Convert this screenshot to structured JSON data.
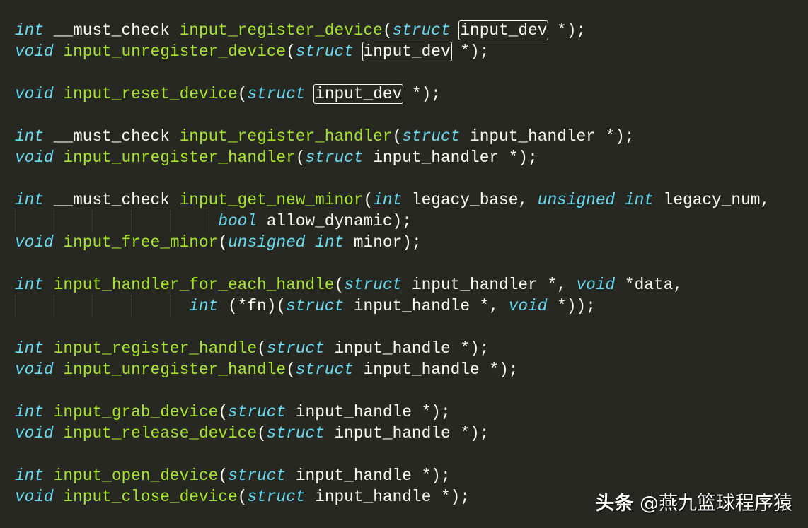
{
  "colors": {
    "background": "#272822",
    "keyword": "#66d9ef",
    "function": "#a6e22e",
    "text": "#f8f8f2"
  },
  "code_lines": [
    [
      [
        "k",
        "int"
      ],
      [
        "t",
        " __must_check "
      ],
      [
        "f",
        "input_register_device"
      ],
      [
        "t",
        "("
      ],
      [
        "k",
        "struct"
      ],
      [
        "t",
        " "
      ],
      [
        "b",
        "input_dev"
      ],
      [
        "t",
        " *);"
      ]
    ],
    [
      [
        "k",
        "void"
      ],
      [
        "t",
        " "
      ],
      [
        "f",
        "input_unregister_device"
      ],
      [
        "t",
        "("
      ],
      [
        "k",
        "struct"
      ],
      [
        "t",
        " "
      ],
      [
        "b",
        "input_dev"
      ],
      [
        "t",
        " *);"
      ]
    ],
    [],
    [
      [
        "k",
        "void"
      ],
      [
        "t",
        " "
      ],
      [
        "f",
        "input_reset_device"
      ],
      [
        "t",
        "("
      ],
      [
        "k",
        "struct"
      ],
      [
        "t",
        " "
      ],
      [
        "b",
        "input_dev"
      ],
      [
        "t",
        " *);"
      ]
    ],
    [],
    [
      [
        "k",
        "int"
      ],
      [
        "t",
        " __must_check "
      ],
      [
        "f",
        "input_register_handler"
      ],
      [
        "t",
        "("
      ],
      [
        "k",
        "struct"
      ],
      [
        "t",
        " input_handler *);"
      ]
    ],
    [
      [
        "k",
        "void"
      ],
      [
        "t",
        " "
      ],
      [
        "f",
        "input_unregister_handler"
      ],
      [
        "t",
        "("
      ],
      [
        "k",
        "struct"
      ],
      [
        "t",
        " input_handler *);"
      ]
    ],
    [],
    [
      [
        "k",
        "int"
      ],
      [
        "t",
        " __must_check "
      ],
      [
        "f",
        "input_get_new_minor"
      ],
      [
        "t",
        "("
      ],
      [
        "k",
        "int"
      ],
      [
        "t",
        " legacy_base, "
      ],
      [
        "k",
        "unsigned"
      ],
      [
        "t",
        " "
      ],
      [
        "k",
        "int"
      ],
      [
        "t",
        " legacy_num,"
      ]
    ],
    [
      [
        "i",
        "                     "
      ],
      [
        "k",
        "bool"
      ],
      [
        "t",
        " allow_dynamic);"
      ]
    ],
    [
      [
        "k",
        "void"
      ],
      [
        "t",
        " "
      ],
      [
        "f",
        "input_free_minor"
      ],
      [
        "t",
        "("
      ],
      [
        "k",
        "unsigned"
      ],
      [
        "t",
        " "
      ],
      [
        "k",
        "int"
      ],
      [
        "t",
        " minor);"
      ]
    ],
    [],
    [
      [
        "k",
        "int"
      ],
      [
        "t",
        " "
      ],
      [
        "f",
        "input_handler_for_each_handle"
      ],
      [
        "t",
        "("
      ],
      [
        "k",
        "struct"
      ],
      [
        "t",
        " input_handler *, "
      ],
      [
        "k",
        "void"
      ],
      [
        "t",
        " *data,"
      ]
    ],
    [
      [
        "i",
        "                  "
      ],
      [
        "k",
        "int"
      ],
      [
        "t",
        " (*fn)("
      ],
      [
        "k",
        "struct"
      ],
      [
        "t",
        " input_handle *, "
      ],
      [
        "k",
        "void"
      ],
      [
        "t",
        " *));"
      ]
    ],
    [],
    [
      [
        "k",
        "int"
      ],
      [
        "t",
        " "
      ],
      [
        "f",
        "input_register_handle"
      ],
      [
        "t",
        "("
      ],
      [
        "k",
        "struct"
      ],
      [
        "t",
        " input_handle *);"
      ]
    ],
    [
      [
        "k",
        "void"
      ],
      [
        "t",
        " "
      ],
      [
        "f",
        "input_unregister_handle"
      ],
      [
        "t",
        "("
      ],
      [
        "k",
        "struct"
      ],
      [
        "t",
        " input_handle *);"
      ]
    ],
    [],
    [
      [
        "k",
        "int"
      ],
      [
        "t",
        " "
      ],
      [
        "f",
        "input_grab_device"
      ],
      [
        "t",
        "("
      ],
      [
        "k",
        "struct"
      ],
      [
        "t",
        " input_handle *);"
      ]
    ],
    [
      [
        "k",
        "void"
      ],
      [
        "t",
        " "
      ],
      [
        "f",
        "input_release_device"
      ],
      [
        "t",
        "("
      ],
      [
        "k",
        "struct"
      ],
      [
        "t",
        " input_handle *);"
      ]
    ],
    [],
    [
      [
        "k",
        "int"
      ],
      [
        "t",
        " "
      ],
      [
        "f",
        "input_open_device"
      ],
      [
        "t",
        "("
      ],
      [
        "k",
        "struct"
      ],
      [
        "t",
        " input_handle *);"
      ]
    ],
    [
      [
        "k",
        "void"
      ],
      [
        "t",
        " "
      ],
      [
        "f",
        "input_close_device"
      ],
      [
        "t",
        "("
      ],
      [
        "k",
        "struct"
      ],
      [
        "t",
        " input_handle *);"
      ]
    ]
  ],
  "watermark": {
    "brand": "头条",
    "handle": " @燕九篮球程序猿"
  }
}
